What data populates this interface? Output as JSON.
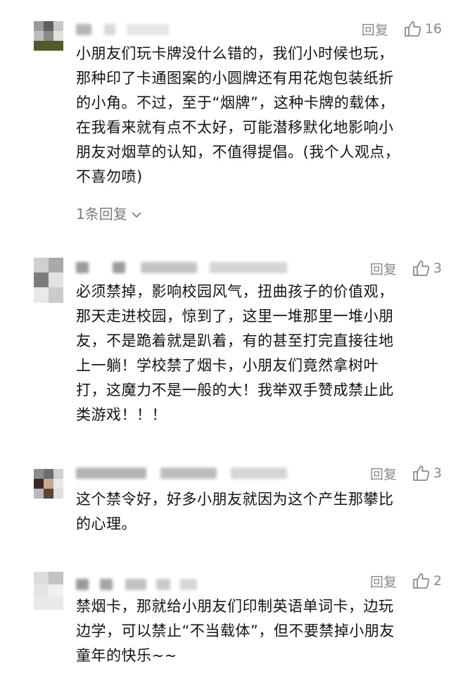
{
  "comments": [
    {
      "reply_label": "回复",
      "likes": "16",
      "text_lines": [
        "小朋友们玩卡牌没什么错的，我们小时候也玩，",
        "那种印了卡通图案的小圆牌还有用花炮包装纸折",
        "的小角。不过，至于“烟牌”，这种卡牌的载体，",
        "在我看来就有点不太好，可能潜移默化地影响小",
        "朋友对烟草的认知，不值得提倡。(我个人观点，",
        "不喜勿喷)"
      ],
      "replies_label": "1条回复"
    },
    {
      "reply_label": "回复",
      "likes": "3",
      "text_lines": [
        "必须禁掉，影响校园风气，扭曲孩子的价值观，",
        "那天走进校园，惊到了，这里一堆那里一堆小朋",
        "友，不是跪着就是趴着，有的甚至打完直接往地",
        "上一躺！学校禁了烟卡，小朋友们竟然拿树叶",
        "打，这魔力不是一般的大！我举双手赞成禁止此",
        "类游戏！！！"
      ]
    },
    {
      "reply_label": "回复",
      "likes": "3",
      "text_lines": [
        "这个禁令好，好多小朋友就因为这个产生那攀比",
        "的心理。"
      ]
    },
    {
      "reply_label": "回复",
      "likes": "2",
      "text_lines": [
        "禁烟卡，那就给小朋友们印制英语单词卡，边玩",
        "边学，可以禁止“不当载体”，但不要禁掉小朋友",
        "童年的快乐~~"
      ]
    }
  ]
}
